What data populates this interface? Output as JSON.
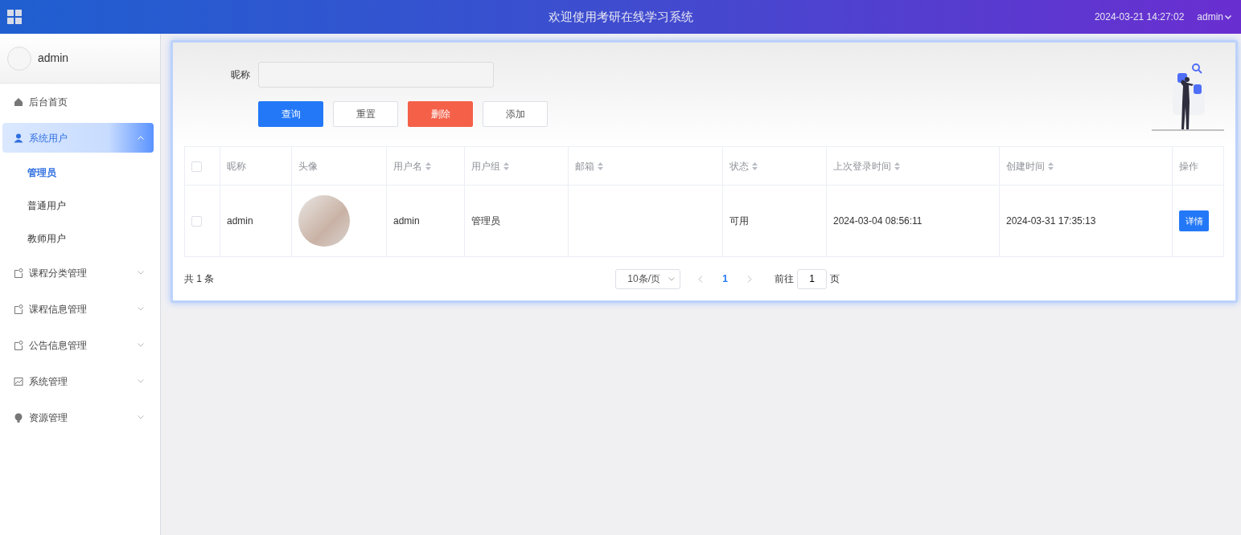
{
  "header": {
    "title": "欢迎使用考研在线学习系统",
    "datetime": "2024-03-21 14:27:02",
    "user": "admin"
  },
  "sidebar": {
    "user_name": "admin",
    "menu": [
      {
        "label": "后台首页",
        "kind": "link",
        "selected": false
      },
      {
        "label": "系统用户",
        "kind": "submenu",
        "selected": true,
        "expanded": true,
        "children": [
          {
            "label": "管理员",
            "selected": true
          },
          {
            "label": "普通用户",
            "selected": false
          },
          {
            "label": "教师用户",
            "selected": false
          }
        ]
      },
      {
        "label": "课程分类管理",
        "kind": "submenu",
        "selected": false,
        "expanded": false
      },
      {
        "label": "课程信息管理",
        "kind": "submenu",
        "selected": false,
        "expanded": false
      },
      {
        "label": "公告信息管理",
        "kind": "submenu",
        "selected": false,
        "expanded": false
      },
      {
        "label": "系统管理",
        "kind": "submenu",
        "selected": false,
        "expanded": false
      },
      {
        "label": "资源管理",
        "kind": "submenu",
        "selected": false,
        "expanded": false
      }
    ]
  },
  "search": {
    "label": "昵称"
  },
  "buttons": [
    {
      "label": "查询",
      "kind": "primary"
    },
    {
      "label": "重置",
      "kind": "default"
    },
    {
      "label": "删除",
      "kind": "danger"
    },
    {
      "label": "添加",
      "kind": "default"
    }
  ],
  "table": {
    "select_all_checked": false,
    "columns": [
      {
        "label": "昵称",
        "sortable": false
      },
      {
        "label": "头像",
        "sortable": false
      },
      {
        "label": "用户名",
        "sortable": true
      },
      {
        "label": "用户组",
        "sortable": true
      },
      {
        "label": "邮箱",
        "sortable": true
      },
      {
        "label": "状态",
        "sortable": true
      },
      {
        "label": "上次登录时间",
        "sortable": true
      },
      {
        "label": "创建时间",
        "sortable": true
      },
      {
        "label": "操作",
        "sortable": false
      }
    ],
    "rows": [
      {
        "checked": false,
        "nickname": "admin",
        "username": "admin",
        "group": "管理员",
        "status": "可用",
        "last_login": "2024-03-04 08:56:11",
        "created": "2024-03-31 17:35:13",
        "action": "详情"
      }
    ]
  },
  "pagination": {
    "total": "共 1 条",
    "page_size": "10条/页",
    "pages": [
      {
        "label": "1",
        "selected": true
      }
    ],
    "goto_label": "前往",
    "goto_value": "1",
    "goto_suffix": "页"
  }
}
